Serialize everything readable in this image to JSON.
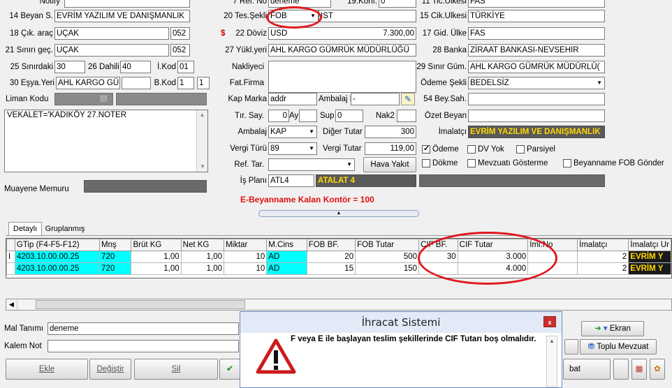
{
  "form": {
    "notify_label": "Notify",
    "ref_no_label": "7 Ref. No",
    "ref_no_value": "deneme",
    "konf_label": "19.Konf.",
    "konf_value": "0",
    "tic_ulkesi_label": "11 Tic.Ülkesi",
    "tic_ulkesi_value": "FAS",
    "beyan_label": "14 Beyan S.",
    "beyan_value": "EVRİM YAZILIM VE DANIŞMANLIK",
    "tes_sekli_label": "20 Tes.Şekli",
    "tes_sekli_value": "FOB",
    "tes_sekli_extra": "IST",
    "cik_ulkesi_label": "15 Cik.Ulkesi",
    "cik_ulkesi_value": "TÜRKİYE",
    "cik_arac_label": "18 Çık. araç",
    "cik_arac_value": "UÇAK",
    "cik_arac_code": "052",
    "doviz_symbol": "$",
    "doviz_label": "22 Döviz",
    "doviz_value": "USD",
    "doviz_amount": "7.300,00",
    "gid_ulke_label": "17 Gid. Ülke",
    "gid_ulke_value": "FAS",
    "sinir_gec_label": "21 Sınırı geç.",
    "sinir_gec_value": "UÇAK",
    "sinir_gec_code": "052",
    "yukl_yeri_label": "27 Yükl.yeri",
    "yukl_yeri_value": "AHL KARGO GÜMRÜK MÜDÜRLÜĞÜ",
    "banka_label": "28 Banka",
    "banka_value": "ZİRAAT BANKASI-NEVSEHIR",
    "sinirdaki_label": "25 Sınırdaki",
    "sinirdaki_value": "30",
    "dahili_label": "26 Dahili",
    "dahili_value": "40",
    "ikod_label": "İ.Kod",
    "ikod_value": "01",
    "nakliyeci_label": "Nakliyeci",
    "sinir_gum_label": "29 Sınır Güm.",
    "sinir_gum_value": "AHL KARGO GÜMRÜK MÜDÜRLÜ(",
    "esya_yeri_label": "30 Eşya.Yeri",
    "esya_yeri_value": "AHL KARGO GÜ",
    "bkod_label": "B.Kod",
    "bkod_value1": "1",
    "bkod_value2": "1",
    "fat_firma_label": "Fat.Firma",
    "odeme_sekli_label": "Ödeme Şekli",
    "odeme_sekli_value": "BEDELSİZ",
    "liman_kodu_label": "Liman Kodu",
    "kap_marka_label": "Kap Marka",
    "kap_marka_value": "addr",
    "ambalaj_no_label": "Ambalaj No",
    "ambalaj_no_value": "-",
    "bey_sah_label": "54 Bey.Sah.",
    "notes_text": "VEKALET='KADIKÖY 27.NOTER",
    "tir_say_label": "Tır. Say.",
    "tir_say_value": "0",
    "ay_label": "Ay",
    "sup_label": "Sup",
    "sup_value": "0",
    "nak2_label": "Nak2",
    "ozet_beyan_label": "Özet Beyan",
    "ambalaj_label": "Ambalaj",
    "ambalaj_value": "KAP",
    "diger_tutar_label": "Diğer Tutar",
    "diger_tutar_value": "300",
    "imalatci_label": "İmalatçı",
    "imalatci_value": "EVRİM YAZILIM VE DANIŞMANLIK",
    "vergi_turu_label": "Vergi Türü",
    "vergi_turu_value": "89",
    "vergi_tutar_label": "Vergi Tutar",
    "vergi_tutar_value": "119,00",
    "ref_tar_label": "Ref. Tar.",
    "hava_yakit_label": "Hava Yakıt",
    "is_plani_label": "İş Planı",
    "is_plani_value": "ATL4",
    "is_plani_name": "ATALAT 4",
    "muayene_label": "Muayene Memuru",
    "kontor_text": "E-Beyanname Kalan Kontör = 100"
  },
  "checks": {
    "odeme": "Ödeme",
    "dv_yok": "DV Yok",
    "parsiyel": "Parsiyel",
    "dokme": "Dökme",
    "mevzuati": "Mevzuatı Gösterme",
    "fob_gonder": "Beyanname FOB Gönder"
  },
  "tabs": {
    "detayli": "Detaylı",
    "gruplanmis": "Gruplanmış"
  },
  "grid": {
    "headers": [
      "GTip (F4-F5-F12)",
      "Mnş",
      "Brüt KG",
      "Net KG",
      "Miktar",
      "M.Cins",
      "FOB BF.",
      "FOB Tutar",
      "CIF BF.",
      "CIF Tutar",
      "İml.No",
      "İmalatçı",
      "İmalatçı Ur"
    ],
    "rows": [
      {
        "marker": "I",
        "gtip": "4203.10.00.00.25",
        "mns": "720",
        "brut": "1,00",
        "net": "1,00",
        "miktar": "10",
        "mcins": "AD",
        "fob_bf": "20",
        "fob_tutar": "500",
        "cif_bf": "30",
        "cif_tutar": "3.000",
        "iml_no": "",
        "imalatci": "2",
        "imalatci_ur": "EVRİM Y"
      },
      {
        "marker": "",
        "gtip": "4203.10.00.00.25",
        "mns": "720",
        "brut": "1,00",
        "net": "1,00",
        "miktar": "10",
        "mcins": "AD",
        "fob_bf": "15",
        "fob_tutar": "150",
        "cif_bf": "",
        "cif_tutar": "4.000",
        "iml_no": "",
        "imalatci": "2",
        "imalatci_ur": "EVRİM Y"
      }
    ]
  },
  "bottom": {
    "mal_tanimi_label": "Mal Tanımı",
    "mal_tanimi_value": "deneme",
    "kalem_not_label": "Kalem Not",
    "ekle": "Ekle",
    "degistir": "Değiştir",
    "sil": "Sil",
    "ekran": "Ekran",
    "toplu_mevzuat": "Toplu Mevzuat",
    "bat": "bat"
  },
  "dialog": {
    "title": "İhracat Sistemi",
    "close": "x",
    "message": "F veya E ile başlayan teslim şekillerinde CIF Tutarı boş olmalıdır."
  }
}
